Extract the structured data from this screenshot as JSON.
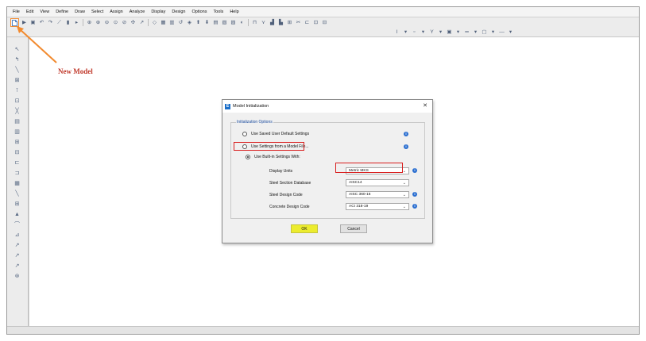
{
  "menubar": {
    "items": [
      "File",
      "Edit",
      "View",
      "Define",
      "Draw",
      "Select",
      "Assign",
      "Analyze",
      "Display",
      "Design",
      "Options",
      "Tools",
      "Help"
    ]
  },
  "annotation": {
    "label": "New Model",
    "color": "#c0392b",
    "arrow_color": "#f28a2e"
  },
  "dialog": {
    "title": "Model Initialization",
    "group_title": "Initialization Options",
    "options": [
      {
        "label": "Use Saved User Default Settings",
        "selected": false
      },
      {
        "label": "Use Settings from a Model File...",
        "selected": false
      },
      {
        "label": "Use Built-in Settings With:",
        "selected": true
      }
    ],
    "settings": [
      {
        "label": "Display Units",
        "value": "Metric MKS"
      },
      {
        "label": "Steel Section Database",
        "value": "AISC14"
      },
      {
        "label": "Steel Design Code",
        "value": "AISC 360-16"
      },
      {
        "label": "Concrete Design Code",
        "value": "ACI 318-19"
      }
    ],
    "ok_label": "OK",
    "cancel_label": "Cancel",
    "highlight_color": "#d81e1e",
    "ok_highlight_color": "#ecec2e"
  }
}
